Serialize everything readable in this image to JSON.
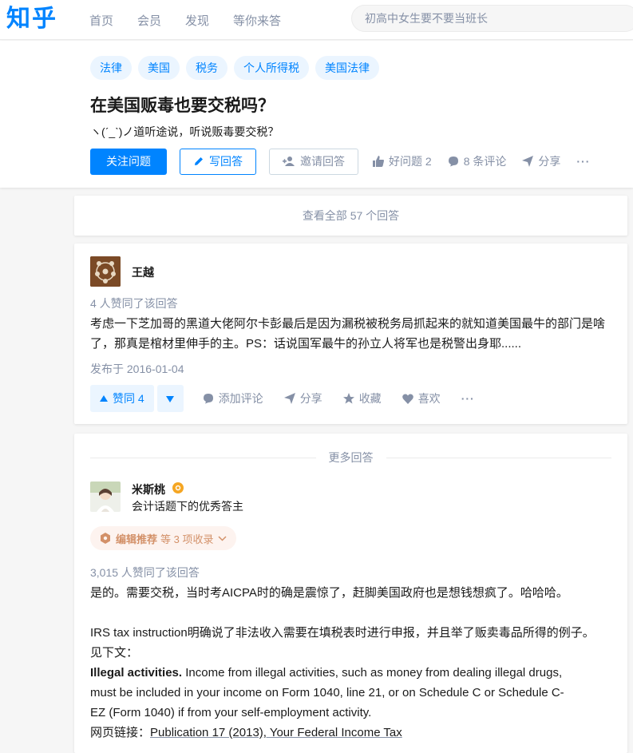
{
  "header": {
    "logo": "知乎",
    "nav": [
      "首页",
      "会员",
      "发现",
      "等你来答"
    ],
    "search_placeholder": "初高中女生要不要当班长"
  },
  "question": {
    "tags": [
      "法律",
      "美国",
      "税务",
      "个人所得税",
      "美国法律"
    ],
    "title": "在美国贩毒也要交税吗？",
    "detail": "ヽ(ˊ_ˋ)ノ道听途说，听说贩毒要交税？",
    "follow_label": "关注问题",
    "write_label": "写回答",
    "invite_label": "邀请回答",
    "like_label": "好问题 2",
    "comments_label": "8 条评论",
    "share_label": "分享",
    "more_label": "···"
  },
  "view_all_label": "查看全部 57 个回答",
  "answer1": {
    "author": "王越",
    "voters": "4 人赞同了该回答",
    "text_line1": "考虑一下芝加哥的黑道大佬阿尔卡彭最后是因为漏税被税务局抓起来的就知道美国最牛的部门是啥",
    "text_line2": "了，那真是棺材里伸手的主。PS：话说国军最牛的孙立人将军也是税警出身耶......",
    "date": "发布于 2016-01-04",
    "upvote_label": "赞同 4",
    "comment_label": "添加评论",
    "share_label": "分享",
    "collect_label": "收藏",
    "like_label": "喜欢",
    "more_label": "···"
  },
  "answer2": {
    "divider_label": "更多回答",
    "author": "米斯桃",
    "author_desc": "会计话题下的优秀答主",
    "recommend_label": "编辑推荐",
    "recommend_extra": "等 3 项收录",
    "voters": "3,015 人赞同了该回答",
    "para1": "是的。需要交税，当时考AICPA时的确是震惊了，赶脚美国政府也是想钱想疯了。哈哈哈。",
    "para2_line1": "IRS tax instruction明确说了非法收入需要在填税表时进行申报，并且举了贩卖毒品所得的例子。",
    "para2_line2": "见下文：",
    "bold_term": "Illegal activities.",
    "para3_line1": " Income from illegal activities, such as money from dealing illegal drugs,",
    "para3_line2": "must be included in your income on Form 1040, line 21, or on Schedule C or Schedule C-",
    "para3_line3": "EZ (Form 1040) if from your self-employment activity.",
    "link_prefix": "网页链接：",
    "link_text": "Publication 17 (2013), Your Federal Income Tax"
  },
  "colors": {
    "brand": "#0084ff",
    "muted": "#8590a6",
    "tag_bg": "#ebf5ff",
    "recommend": "#d39169"
  }
}
